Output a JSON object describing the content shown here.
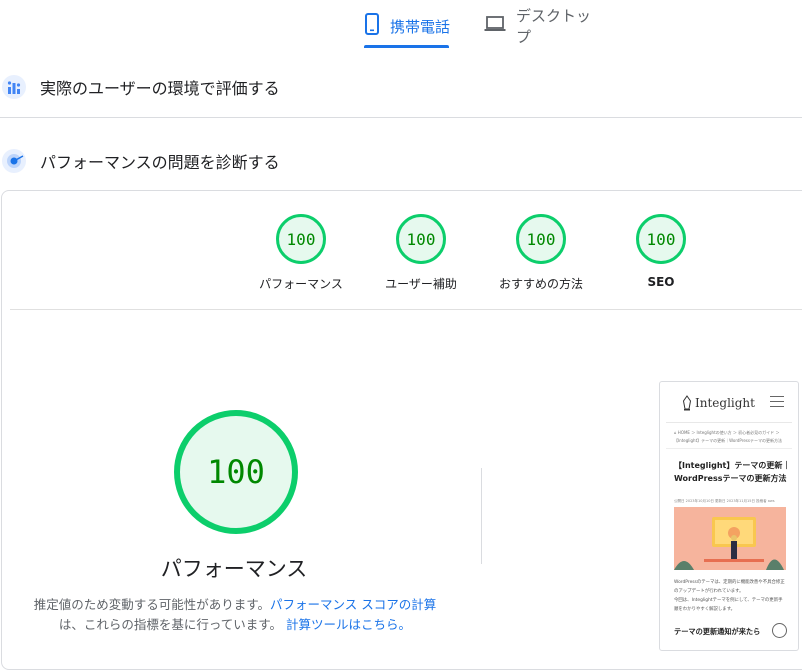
{
  "tabs": {
    "mobile": {
      "label": "携帯電話",
      "icon": "smartphone-icon",
      "active": true
    },
    "desktop": {
      "label": "デスクトップ",
      "icon": "laptop-icon",
      "active": false
    }
  },
  "sections": {
    "field_data": {
      "title": "実際のユーザーの環境で評価する",
      "icon": "users-chart-icon"
    },
    "diagnose": {
      "title": "パフォーマンスの問題を診断する",
      "icon": "lighthouse-icon"
    }
  },
  "categories": [
    {
      "label": "パフォーマンス",
      "score": "100"
    },
    {
      "label": "ユーザー補助",
      "score": "100"
    },
    {
      "label": "おすすめの方法",
      "score": "100"
    },
    {
      "label": "SEO",
      "score": "100"
    }
  ],
  "main_gauge": {
    "score": "100",
    "label": "パフォーマンス"
  },
  "notes": {
    "line1_text": "推定値のため変動する可能性があります。",
    "line1_link": "パフォーマンス スコアの計算",
    "line2_text": "は、これらの指標を基に行っています。",
    "line2_link": "計算ツールはこちら。"
  },
  "screenshot": {
    "logo": "Integlight",
    "breadcrumb1": "⌂ HOME ＞ Integlightの使い方 ＞ 初心者必見のガイド ＞",
    "breadcrumb2": "【Integlight】テーマの更新｜WordPressテーマの更新方法",
    "title": "【Integlight】テーマの更新｜WordPressテーマの更新方法",
    "date": "公開日 2023年10月10日  更新日 2023年11月15日  投稿者 aws",
    "text1": "WordPressのテーマは、定期的に機能改善や不具合修正",
    "text2": "のアップデートが行われています。",
    "text3": "今回は、Integlightテーマを例にして、テーマの更新手",
    "text4": "順をわかりやすく解説します。",
    "notify": "テーマの更新通知が来たら"
  },
  "colors": {
    "accent": "#1a73e8",
    "pass": "#0cce6b",
    "pass_fill": "#e6f9ee",
    "pass_text": "#008800"
  }
}
